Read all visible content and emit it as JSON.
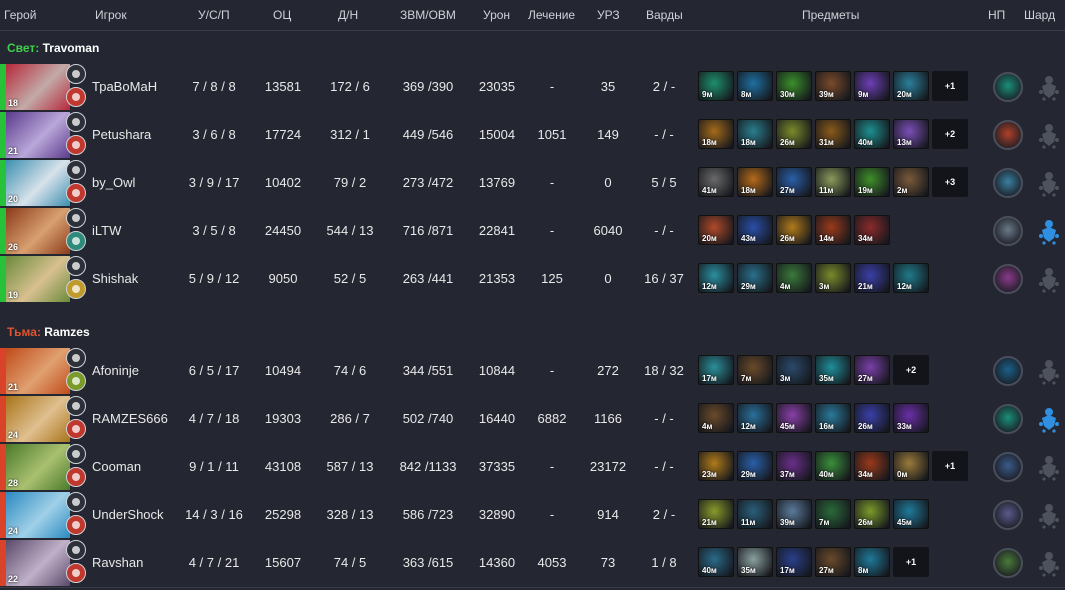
{
  "headers": {
    "hero": "Герой",
    "player": "Игрок",
    "kda": "У/С/П",
    "nw": "ОЦ",
    "lhdn": "Д/Н",
    "gpmxpm": "ЗВМ/ОВМ",
    "damage": "Урон",
    "heal": "Лечение",
    "tower": "УРЗ",
    "wards": "Варды",
    "items": "Предметы",
    "neutral": "НП",
    "shard": "Шард"
  },
  "colors": {
    "background": "#242731",
    "radiant": "#3fd14a",
    "dire": "#e2532e",
    "radiant_bar": "#27c23a",
    "dire_bar": "#d8432a"
  },
  "teams": [
    {
      "side_label": "Свет:",
      "team_name": "Travoman",
      "players": [
        {
          "level": "18",
          "name": "ТраВоМаН",
          "kda": "7 / 8 / 8",
          "nw": "13581",
          "lhdn": "172 / 6",
          "gpmxpm": "369 /390",
          "damage": "23035",
          "heal": "-",
          "tower": "35",
          "wards": "2 / -",
          "portrait": [
            "#b7283a",
            "#c2aaa8"
          ],
          "facet": "#c0372e",
          "items": [
            {
              "t": "9м",
              "c": "#1d8f6b"
            },
            {
              "t": "8м",
              "c": "#1e6fa1"
            },
            {
              "t": "30м",
              "c": "#3a8f2a"
            },
            {
              "t": "39м",
              "c": "#7a4a2a"
            },
            {
              "t": "9м",
              "c": "#6c3fb5"
            },
            {
              "t": "20м",
              "c": "#2a7f9a"
            }
          ],
          "more": "+1",
          "neutral": "#1a8f7a",
          "shard": false
        },
        {
          "level": "21",
          "name": "Petushara",
          "kda": "3 / 6 / 8",
          "nw": "17724",
          "lhdn": "312 / 1",
          "gpmxpm": "449 /546",
          "damage": "15004",
          "heal": "1051",
          "tower": "149",
          "wards": "- / -",
          "portrait": [
            "#5b3a8c",
            "#b9a7d9"
          ],
          "facet": "#c0372e",
          "items": [
            {
              "t": "18м",
              "c": "#a56a1a"
            },
            {
              "t": "18м",
              "c": "#2b7d8e"
            },
            {
              "t": "26м",
              "c": "#7a8a2a"
            },
            {
              "t": "31м",
              "c": "#8a5a1a"
            },
            {
              "t": "40м",
              "c": "#1e8f8f"
            },
            {
              "t": "13м",
              "c": "#7b4fb8"
            }
          ],
          "more": "+2",
          "neutral": "#b0402a",
          "shard": false
        },
        {
          "level": "20",
          "name": "by_Owl",
          "kda": "3 / 9 / 17",
          "nw": "10402",
          "lhdn": "79 / 2",
          "gpmxpm": "273 /472",
          "damage": "13769",
          "heal": "-",
          "tower": "0",
          "wards": "5 / 5",
          "portrait": [
            "#3c8fb0",
            "#d7e2ea"
          ],
          "facet": "#c0372e",
          "items": [
            {
              "t": "41м",
              "c": "#6a6a6a"
            },
            {
              "t": "18м",
              "c": "#b56a1a"
            },
            {
              "t": "27м",
              "c": "#2a5fa8"
            },
            {
              "t": "11м",
              "c": "#8a9a5a"
            },
            {
              "t": "19м",
              "c": "#3f8f2a"
            },
            {
              "t": "2м",
              "c": "#7a5a3a"
            }
          ],
          "more": "+3",
          "neutral": "#3a7fa0",
          "shard": false
        },
        {
          "level": "26",
          "name": "iLTW",
          "kda": "3 / 5 / 8",
          "nw": "24450",
          "lhdn": "544 / 13",
          "gpmxpm": "716 /871",
          "damage": "22841",
          "heal": "-",
          "tower": "6040",
          "wards": "- / -",
          "portrait": [
            "#8a3a1a",
            "#d8a070"
          ],
          "facet": "#2e8a7a",
          "items": [
            {
              "t": "20м",
              "c": "#b04a2a"
            },
            {
              "t": "43м",
              "c": "#2a4fa8"
            },
            {
              "t": "26м",
              "c": "#b07a1a"
            },
            {
              "t": "14м",
              "c": "#9a3a1a"
            },
            {
              "t": "34м",
              "c": "#8a2a2a"
            }
          ],
          "more": "",
          "neutral": "#6a7a8a",
          "shard": true
        },
        {
          "level": "19",
          "name": "Shishak",
          "kda": "5 / 9 / 12",
          "nw": "9050",
          "lhdn": "52 / 5",
          "gpmxpm": "263 /441",
          "damage": "21353",
          "heal": "125",
          "tower": "0",
          "wards": "16 / 37",
          "portrait": [
            "#6a8a3a",
            "#d8c090"
          ],
          "facet": "#c09a2a",
          "items": [
            {
              "t": "12м",
              "c": "#2a8fa0"
            },
            {
              "t": "29м",
              "c": "#2a6f8a"
            },
            {
              "t": "4м",
              "c": "#3a7a3a"
            },
            {
              "t": "3м",
              "c": "#7a8a2a"
            },
            {
              "t": "21м",
              "c": "#3a3fa8"
            },
            {
              "t": "12м",
              "c": "#1f7a8a"
            }
          ],
          "more": "",
          "neutral": "#8a3a8a",
          "shard": false
        }
      ]
    },
    {
      "side_label": "Тьма:",
      "team_name": "Ramzes",
      "players": [
        {
          "level": "21",
          "name": "Afoninje",
          "kda": "6 / 5 / 17",
          "nw": "10494",
          "lhdn": "74 / 6",
          "gpmxpm": "344 /551",
          "damage": "10844",
          "heal": "-",
          "tower": "272",
          "wards": "18 / 32",
          "portrait": [
            "#c04a1a",
            "#e0a070"
          ],
          "facet": "#7a9a2a",
          "items": [
            {
              "t": "17м",
              "c": "#2a8f9a"
            },
            {
              "t": "7м",
              "c": "#6a4a2a"
            },
            {
              "t": "3м",
              "c": "#2a4a6a"
            },
            {
              "t": "35м",
              "c": "#1f8f9a"
            },
            {
              "t": "27м",
              "c": "#7a3fa8"
            }
          ],
          "more": "+2",
          "neutral": "#1a5f8a",
          "shard": false
        },
        {
          "level": "24",
          "name": "RAMZES666",
          "kda": "4 / 7 / 18",
          "nw": "19303",
          "lhdn": "286 / 7",
          "gpmxpm": "502 /740",
          "damage": "16440",
          "heal": "6882",
          "tower": "1166",
          "wards": "- / -",
          "portrait": [
            "#a8741a",
            "#e0c090"
          ],
          "facet": "#c0372e",
          "items": [
            {
              "t": "4м",
              "c": "#6a4a2a"
            },
            {
              "t": "12м",
              "c": "#2a6f9a"
            },
            {
              "t": "45м",
              "c": "#8a3fa8"
            },
            {
              "t": "16м",
              "c": "#2a7a9a"
            },
            {
              "t": "26м",
              "c": "#3a3fa8"
            },
            {
              "t": "33м",
              "c": "#6a2fa8"
            }
          ],
          "more": "",
          "neutral": "#1a8f7a",
          "shard": true
        },
        {
          "level": "28",
          "name": "Cooman",
          "kda": "9 / 1 / 11",
          "nw": "43108",
          "lhdn": "587 / 13",
          "gpmxpm": "842 /1133",
          "damage": "37335",
          "heal": "-",
          "tower": "23172",
          "wards": "- / -",
          "portrait": [
            "#4a7a2a",
            "#a8c070"
          ],
          "facet": "#c0372e",
          "items": [
            {
              "t": "23м",
              "c": "#b07a1a"
            },
            {
              "t": "29м",
              "c": "#2a5fa8"
            },
            {
              "t": "37м",
              "c": "#6a2f8a"
            },
            {
              "t": "40м",
              "c": "#3a8f3a"
            },
            {
              "t": "34м",
              "c": "#9a3a1a"
            },
            {
              "t": "0м",
              "c": "#9a7a3a"
            }
          ],
          "more": "+1",
          "neutral": "#3a5a8a",
          "shard": false
        },
        {
          "level": "24",
          "name": "UnderShock",
          "kda": "14 / 3 / 16",
          "nw": "25298",
          "lhdn": "328 / 13",
          "gpmxpm": "586 /723",
          "damage": "32890",
          "heal": "-",
          "tower": "914",
          "wards": "2 / -",
          "portrait": [
            "#2a8ac0",
            "#a0d0e8"
          ],
          "facet": "#c0372e",
          "items": [
            {
              "t": "21м",
              "c": "#8a9a2a"
            },
            {
              "t": "11м",
              "c": "#2a5f7a"
            },
            {
              "t": "39м",
              "c": "#5a7a9a"
            },
            {
              "t": "7м",
              "c": "#2a6a3a"
            },
            {
              "t": "26м",
              "c": "#7a9a2a"
            },
            {
              "t": "45м",
              "c": "#1f7a9a"
            }
          ],
          "more": "",
          "neutral": "#5a5a8a",
          "shard": false
        },
        {
          "level": "22",
          "name": "Ravshan",
          "kda": "4 / 7 / 21",
          "nw": "15607",
          "lhdn": "74 / 5",
          "gpmxpm": "363 /615",
          "damage": "14360",
          "heal": "4053",
          "tower": "73",
          "wards": "1 / 8",
          "portrait": [
            "#5a4a6a",
            "#c0b0c8"
          ],
          "facet": "#c0372e",
          "items": [
            {
              "t": "40м",
              "c": "#2a6a8a"
            },
            {
              "t": "35м",
              "c": "#8aa0a0"
            },
            {
              "t": "17м",
              "c": "#2a3f8a"
            },
            {
              "t": "27м",
              "c": "#6a4a2a"
            },
            {
              "t": "8м",
              "c": "#1f7a9a"
            }
          ],
          "more": "+1",
          "neutral": "#4a7a3a",
          "shard": false
        }
      ]
    }
  ]
}
